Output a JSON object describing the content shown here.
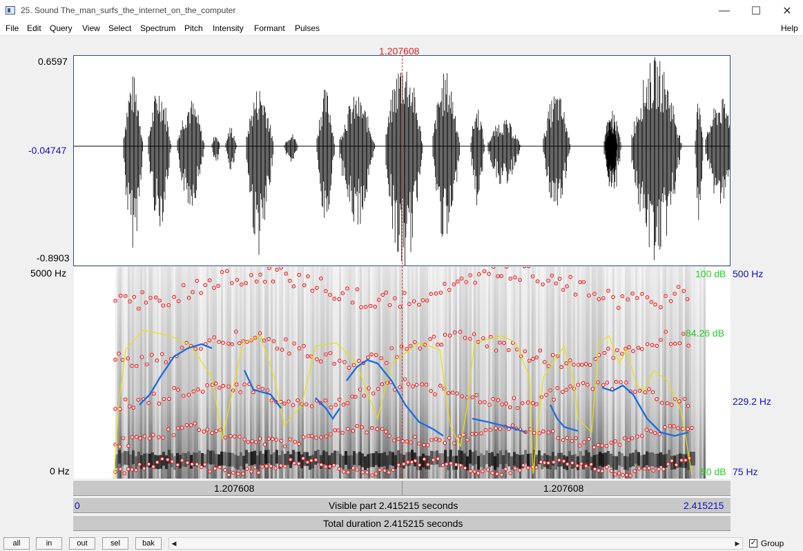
{
  "window": {
    "title": "25. Sound The_man_surfs_the_internet_on_the_computer",
    "minimize": "—",
    "maximize": "☐",
    "close": "✕"
  },
  "menu": {
    "items": [
      "File",
      "Edit",
      "Query",
      "View",
      "Select",
      "Spectrum",
      "Pitch",
      "Intensity",
      "Formant",
      "Pulses"
    ],
    "help": "Help"
  },
  "waveform": {
    "cursor_time": "1.207608",
    "y_max": "0.6597",
    "y_mid": "-0.04747",
    "y_min": "-0.8903"
  },
  "spectrogram": {
    "freq_top": "5000 Hz",
    "freq_bottom": "0 Hz",
    "intensity_top": "100 dB",
    "intensity_cursor": "84.26 dB",
    "intensity_bottom": "50 dB",
    "pitch_top": "500 Hz",
    "pitch_cursor": "229.2 Hz",
    "pitch_bottom": "75 Hz"
  },
  "time_bars": {
    "left_segment": "1.207608",
    "right_segment": "1.207608",
    "visible_start": "0",
    "visible_label": "Visible part 2.415215 seconds",
    "visible_end": "2.415215",
    "total_label": "Total duration 2.415215 seconds"
  },
  "toolbar": {
    "all": "all",
    "in": "in",
    "out": "out",
    "sel": "sel",
    "bak": "bak",
    "scroll_left": "◀",
    "scroll_right": "▶",
    "group_label": "Group",
    "group_checked": "✓"
  },
  "colors": {
    "cursor": "#e02020",
    "pitch": "#1a6ee0",
    "intensity": "#e8e000",
    "formant": "#e81818",
    "axis_blue": "#1010c0",
    "axis_green": "#20d020"
  }
}
